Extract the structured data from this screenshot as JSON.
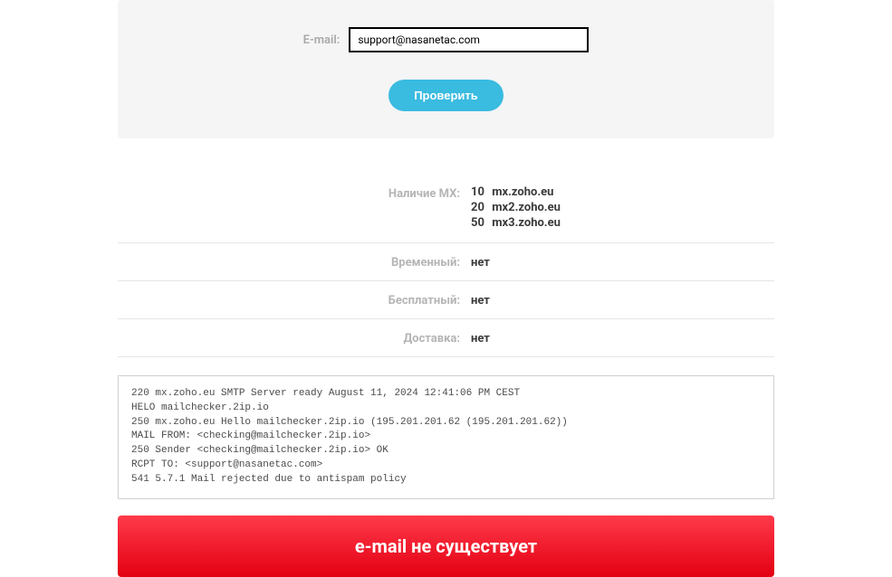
{
  "form": {
    "email_label": "E-mail:",
    "email_value": "support@nasanetac.com",
    "check_button_label": "Проверить"
  },
  "results": {
    "mx_label": "Наличие MX:",
    "mx_records": [
      {
        "priority": "10",
        "host": "mx.zoho.eu"
      },
      {
        "priority": "20",
        "host": "mx2.zoho.eu"
      },
      {
        "priority": "50",
        "host": "mx3.zoho.eu"
      }
    ],
    "temporary_label": "Временный:",
    "temporary_value": "нет",
    "free_label": "Бесплатный:",
    "free_value": "нет",
    "delivery_label": "Доставка:",
    "delivery_value": "нет"
  },
  "smtp_log": "220 mx.zoho.eu SMTP Server ready August 11, 2024 12:41:06 PM CEST\nHELO mailchecker.2ip.io\n250 mx.zoho.eu Hello mailchecker.2ip.io (195.201.201.62 (195.201.201.62))\nMAIL FROM: <checking@mailchecker.2ip.io>\n250 Sender <checking@mailchecker.2ip.io> OK\nRCPT TO: <support@nasanetac.com>\n541 5.7.1 Mail rejected due to antispam policy",
  "status_message": "e-mail не существует",
  "colors": {
    "accent": "#3abbe0",
    "error": "#e20012"
  }
}
